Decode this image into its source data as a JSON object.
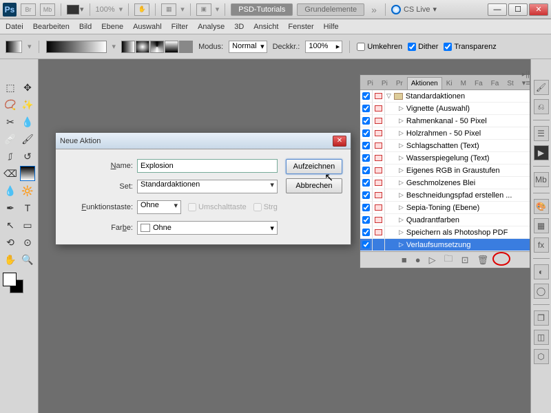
{
  "titlebar": {
    "zoom": "100%",
    "docs": [
      "PSD-Tutorials",
      "Grundelemente"
    ],
    "cslive": "CS Live"
  },
  "menu": [
    "Datei",
    "Bearbeiten",
    "Bild",
    "Ebene",
    "Auswahl",
    "Filter",
    "Analyse",
    "3D",
    "Ansicht",
    "Fenster",
    "Hilfe"
  ],
  "options": {
    "modus_lbl": "Modus:",
    "modus_val": "Normal",
    "deck_lbl": "Deckkr.:",
    "deck_val": "100%",
    "umkehren": "Umkehren",
    "dither": "Dither",
    "transp": "Transparenz"
  },
  "panel": {
    "tabs": [
      "Pi",
      "Pi",
      "Pr",
      "Aktionen",
      "Ki",
      "M",
      "Fa",
      "Fa",
      "St"
    ],
    "folder": "Standardaktionen",
    "items": [
      {
        "name": "Vignette (Auswahl)"
      },
      {
        "name": "Rahmenkanal - 50 Pixel"
      },
      {
        "name": "Holzrahmen - 50 Pixel"
      },
      {
        "name": "Schlagschatten (Text)"
      },
      {
        "name": "Wasserspiegelung (Text)"
      },
      {
        "name": "Eigenes RGB in Graustufen"
      },
      {
        "name": "Geschmolzenes Blei"
      },
      {
        "name": "Beschneidungspfad erstellen ..."
      },
      {
        "name": "Sepia-Toning (Ebene)"
      },
      {
        "name": "Quadrantfarben"
      },
      {
        "name": "Speichern als Photoshop PDF"
      },
      {
        "name": "Verlaufsumsetzung",
        "sel": true,
        "nodlg": true
      }
    ]
  },
  "dialog": {
    "title": "Neue Aktion",
    "name_lbl": "Name:",
    "name_val": "Explosion",
    "set_lbl": "Set:",
    "set_val": "Standardaktionen",
    "func_lbl": "Funktionstaste:",
    "func_val": "Ohne",
    "shift": "Umschalttaste",
    "ctrl": "Strg",
    "farbe_lbl": "Farbe:",
    "farbe_val": "Ohne",
    "record": "Aufzeichnen",
    "cancel": "Abbrechen"
  }
}
